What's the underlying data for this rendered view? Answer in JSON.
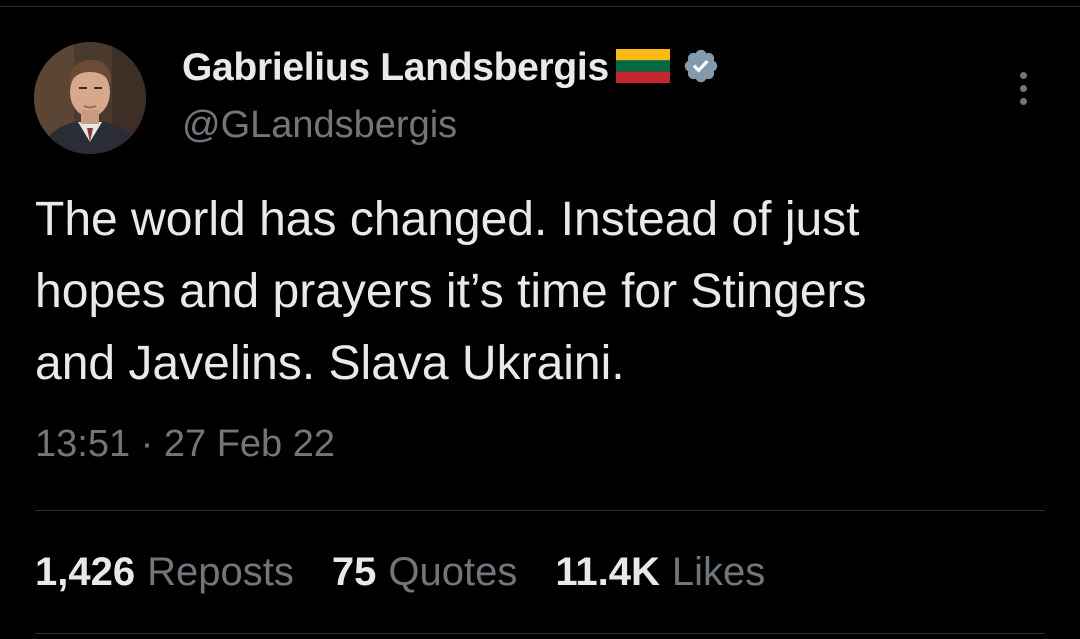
{
  "author": {
    "display_name": "Gabrielius Landsbergis",
    "handle": "@GLandsbergis",
    "flag_icon": "lithuania-flag-icon",
    "verified_icon": "verified-badge-icon",
    "flag_colors": [
      "#fdb913",
      "#006a44",
      "#c1272d"
    ],
    "verified_color": "#829aab"
  },
  "menu": {
    "icon": "more-options-icon"
  },
  "tweet": {
    "lines": [
      "The world has changed. Instead of just",
      "hopes and prayers it’s time for Stingers",
      "and Javelins. Slava Ukraini."
    ],
    "timestamp": "13:51 · 27 Feb 22"
  },
  "stats": {
    "reposts": {
      "count": "1,426",
      "label": "Reposts"
    },
    "quotes": {
      "count": "75",
      "label": "Quotes"
    },
    "likes": {
      "count": "11.4K",
      "label": "Likes"
    }
  },
  "colors": {
    "background": "#000000",
    "text_primary": "#e7e9ea",
    "text_secondary": "#71767b",
    "divider": "#2f3336"
  }
}
